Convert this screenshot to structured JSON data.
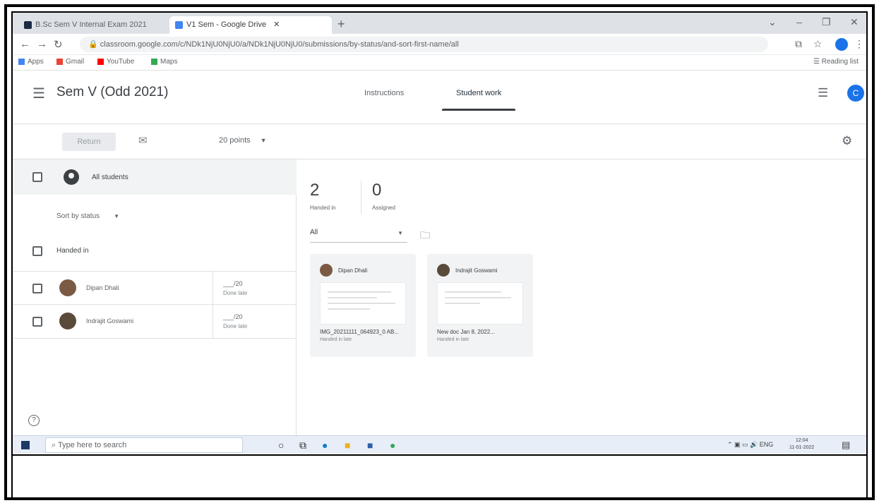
{
  "browser": {
    "tabs": [
      {
        "label": "B.Sc Sem V Internal Exam 2021",
        "fav_color": "#1b2a44"
      },
      {
        "label": "V1 Sem - Google Drive",
        "fav_color": "#4285f4"
      }
    ],
    "new_tab": "+",
    "url": "classroom.google.com/c/NDk1NjU0NjU0/a/NDk1NjU0NjU0/submissions/by-status/and-sort-first-name/all",
    "bookmarks": [
      {
        "label": "Apps",
        "color": "#4285f4"
      },
      {
        "label": "Gmail",
        "color": "#ea4335"
      },
      {
        "label": "YouTube",
        "color": "#ff0000"
      },
      {
        "label": "Maps",
        "color": "#34a853"
      }
    ],
    "reading_list": "Reading list",
    "profile_color": "#1a73e8"
  },
  "header": {
    "class_title": "Sem V (Odd 2021)",
    "tabs": [
      {
        "label": "Instructions",
        "active": false
      },
      {
        "label": "Student work",
        "active": true
      }
    ],
    "avatar_letter": "C"
  },
  "actions": {
    "return_label": "Return",
    "points_label": "20 points"
  },
  "roster": {
    "all_students_label": "All students",
    "sort_label": "Sort by status",
    "group_label": "Handed in",
    "students": [
      {
        "name": "Dipan Dhali",
        "grade": "___/20",
        "status": "Done late",
        "avatar_color": "#7b5a44"
      },
      {
        "name": "Indrajit Goswami",
        "grade": "___/20",
        "status": "Done late",
        "avatar_color": "#5a4a3a"
      }
    ]
  },
  "summary": {
    "handed_in_count": "2",
    "handed_in_label": "Handed in",
    "assigned_count": "0",
    "assigned_label": "Assigned"
  },
  "filter": {
    "value": "All"
  },
  "cards": [
    {
      "name": "Dipan Dhali",
      "file": "IMG_20211111_064923_0 AB...",
      "status": "Handed in late",
      "avatar_color": "#7b5a44"
    },
    {
      "name": "Indrajit Goswami",
      "file": "New doc Jan 8, 2022...",
      "status": "Handed in late",
      "avatar_color": "#5a4a3a"
    }
  ],
  "taskbar": {
    "search_placeholder": "Type here to search",
    "tray_text": "ENG",
    "time": "12:04",
    "date": "11-01-2022"
  }
}
